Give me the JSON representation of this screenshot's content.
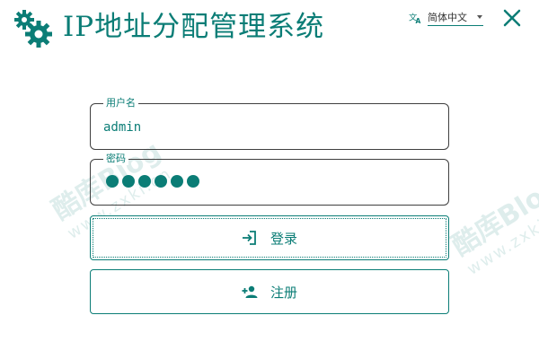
{
  "header": {
    "app_title": "IP地址分配管理系统",
    "logo_icon": "gears-icon",
    "language": {
      "icon": "translate-icon",
      "selected": "简体中文"
    },
    "close_icon": "close-icon"
  },
  "watermark": {
    "brand": "酷库Blog",
    "url": "www.zxki.cn"
  },
  "login_form": {
    "username": {
      "label": "用户名",
      "value": "admin"
    },
    "password": {
      "label": "密码",
      "masked_length": 6
    },
    "login_button": {
      "label": "登录",
      "icon": "login-icon"
    },
    "register_button": {
      "label": "注册",
      "icon": "add-user-icon"
    }
  },
  "colors": {
    "accent": "#0b7d76",
    "border": "#3f3f3f",
    "background": "#ffffff"
  }
}
